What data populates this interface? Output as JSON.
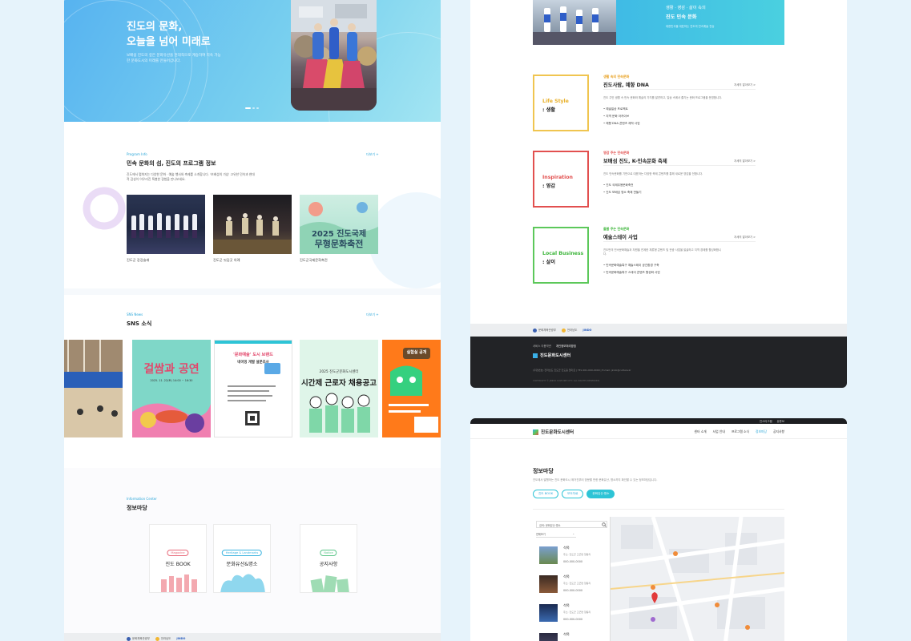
{
  "left": {
    "hero": {
      "title": "진도의 문화,\n오늘을 넘어 미래로",
      "desc": "보배섬 진도의 깊은 문화유산을 현대적으로 계승하여 지속 가능한 문화도시의 미래를 만들어갑니다."
    },
    "program": {
      "label": "Program Info",
      "title": "민속 문화의 섬, 진도의 프로그램 정보",
      "more": "더보기 +",
      "desc": "진도에서 펼쳐지는 다양한 문화 · 예술 행사와 축제를 소개합니다. '보배섬의 가삼' 고유한 민속과 현대적 감성이 어우러진 특별한 경험을 만나보세요.",
      "cards": [
        "진도군 강강술래",
        "진도군 씻김굿 의례",
        "진도군국제문화축전"
      ]
    },
    "sns": {
      "label": "SNS News",
      "title": "SNS 소식",
      "more": "더보기 +",
      "posters": [
        {
          "title": "",
          "caption": ""
        },
        {
          "title": "걸쌈과 공연",
          "caption": "2025. 11. 22(토) 14:00 ~ 16:30"
        },
        {
          "title": "'문화예술' 도시 브랜드",
          "caption": "네이밍 개발 설문조사"
        },
        {
          "title": "2025 진도군문화도시센터",
          "caption": "시간제 근로자 채용공고"
        },
        {
          "title": "실험실 공개",
          "caption": ""
        }
      ]
    },
    "info": {
      "label": "Information Center",
      "title": "정보마당",
      "cards": [
        {
          "badge": "Magazine",
          "name": "진도 BOOK",
          "color": "#e86a7a"
        },
        {
          "badge": "Heritage & Landmarks",
          "name": "문화유산&명소",
          "color": "#3bb3e0"
        },
        {
          "badge": "Notice",
          "name": "공지사항",
          "color": "#5dc68a"
        }
      ]
    },
    "footer_logos": [
      "문화체육관광부",
      "전라남도",
      "JINDO"
    ]
  },
  "right_top": {
    "banner": {
      "sub": "생활 · 영감 · 삶이 속의",
      "title": "진도 민속 문화",
      "desc": "대한민국을 대표하는 진도의 민속예술 전승"
    },
    "categories": [
      {
        "en": "Life Style",
        "ko": ": 생활",
        "color": "#f0c550",
        "sub": "생활 속의 민속문화",
        "title": "진도사람, 예향 DNA",
        "more": "자세히 알아보기 >",
        "desc": "진도 주민 생활 속 민속 문화와 예술의 가치를 발견하고, 일상 속에서 즐기는 문화 프로그램을 운영합니다.",
        "items": [
          "예술일상 프로젝트",
          "지역 문화 아카이브",
          "예향 DNA 콘텐츠 제작 사업"
        ]
      },
      {
        "en": "Inspiration",
        "ko": ": 영감",
        "color": "#e2504f",
        "sub": "영감 주는 민속문화",
        "title": "보배섬 진도, K-민속문화 축제",
        "more": "자세히 알아보기 >",
        "desc": "진도 민속문화를 기반으로 대표하는 다양한 축제 콘텐츠를 통해 새로운 영감을 전합니다.",
        "items": [
          "진도 국제무용문화축전",
          "진도 보배섬 영소 축제 만들기"
        ]
      },
      {
        "en": "Local Business",
        "ko": ": 살이",
        "color": "#5cc85a",
        "sub": "돌봄 주는 민속문화",
        "title": "예술스테이 사업",
        "more": "자세히 알아보기 >",
        "desc": "진도만의 민속문화예술과 자원을 연계한 체류형 콘텐츠 및 관광 사업을 발굴하고 지역 경제를 활성화합니다.",
        "items": [
          "민속문화예술특구 예술스테이 공간환경 구축",
          "민속문화예술특구 스테이 콘텐츠 활성화 사업"
        ]
      }
    ],
    "footer_logos": [
      "문화체육관광부",
      "전라남도",
      "JINDO"
    ],
    "dark_footer": {
      "links": [
        "서비스 이용약관",
        "개인정보처리방침"
      ],
      "logo": "진도문화도시센터",
      "info": "(우편번호) 전라남도 진도군 진도읍 철마로 | TEL 061-000-0000 | E-mail: jindo@culture.kr",
      "copyright": "COPYRIGHT © JINDO CULTURE CITY. ALL RIGHTS RESERVED."
    }
  },
  "right_bottom": {
    "top_links": [
      "인스타그램",
      "유튜브"
    ],
    "logo": "진도문화도시센터",
    "nav": [
      "센터 소개",
      "사업 안내",
      "프로그램 소식",
      "정보마당",
      "공지사항"
    ],
    "nav_active": 3,
    "title": "정보마당",
    "desc": "진도에서 발행하는 진도 문화도시 매거진부터 방문할 만한 문화유산, 명소까지 확인할 수 있는 정보마당입니다.",
    "tabs": [
      "진도 BOOK",
      "보도자료",
      "문화유산·명소"
    ],
    "tab_active": 2,
    "search_placeholder": "검색: 문화유산·명소",
    "filter": "전체보기",
    "places": [
      {
        "name": "석목",
        "addr": "주소: 진도군 고군면 향동리",
        "phone": "000-000-0000"
      },
      {
        "name": "석목",
        "addr": "주소: 진도군 고군면 향동리",
        "phone": "000-000-0000"
      },
      {
        "name": "석목",
        "addr": "주소: 진도군 고군면 향동리",
        "phone": "000-000-0000"
      },
      {
        "name": "석목",
        "addr": "",
        "phone": ""
      }
    ]
  }
}
